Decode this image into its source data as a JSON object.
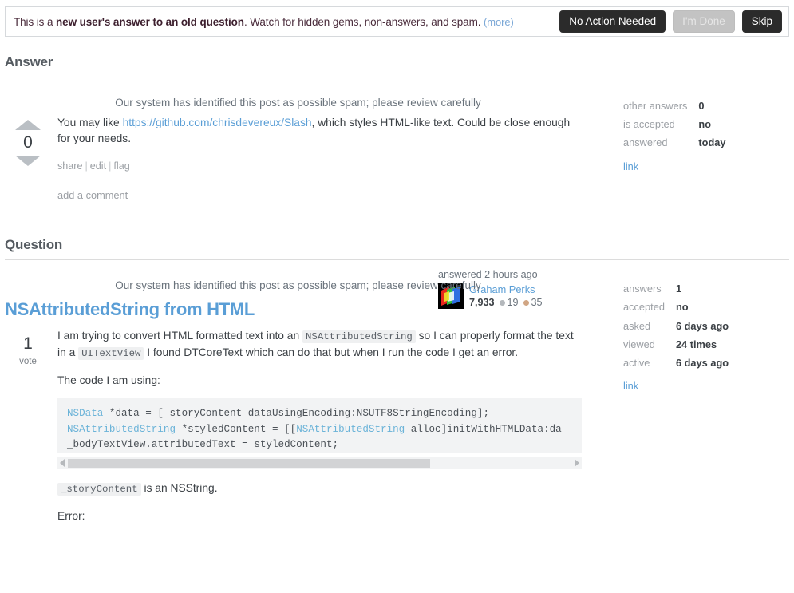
{
  "review": {
    "text_lead": "This is a ",
    "text_bold": "new user's answer to an old question",
    "text_tail": ". Watch for hidden gems, non-answers, and spam. ",
    "more_label": "(more)",
    "buttons": {
      "no_action": "No Action Needed",
      "done": "I'm Done",
      "skip": "Skip"
    }
  },
  "answer_section": {
    "heading": "Answer",
    "spam_notice": "Our system has identified this post as possible spam; please review carefully",
    "score": "0",
    "body_lead": "You may like ",
    "body_link": "https://github.com/chrisdevereux/Slash",
    "body_tail": ", which styles HTML-like text. Could be close enough for your needs.",
    "menu": {
      "share": "share",
      "edit": "edit",
      "flag": "flag"
    },
    "add_comment": "add a comment",
    "signature": {
      "action": "answered 2 hours ago",
      "user": "Graham Perks",
      "reputation": "7,933",
      "silver_badges": "19",
      "bronze_badges": "35"
    },
    "stats": {
      "rows": [
        {
          "key": "other answers",
          "value": "0"
        },
        {
          "key": "is accepted",
          "value": "no"
        },
        {
          "key": "answered",
          "value": "today"
        }
      ],
      "link": "link"
    }
  },
  "question_section": {
    "heading": "Question",
    "spam_notice": "Our system has identified this post as possible spam; please review carefully",
    "title": "NSAttributedString from HTML",
    "score": "1",
    "score_label": "vote",
    "para1": {
      "a": "I am trying to convert HTML formatted text into an ",
      "code1": "NSAttributedString",
      "b": " so I can properly format the text in a ",
      "code2": "UITextView",
      "c": " I found DTCoreText which can do that but when I run the code I get an error."
    },
    "para2": "The code I am using:",
    "code_lines": [
      {
        "type": "NSData",
        "rest": " *data = [_storyContent dataUsingEncoding:NSUTF8StringEncoding];"
      },
      {
        "type": "NSAttributedString",
        "rest": " *styledContent = [[",
        "type2": "NSAttributedString",
        "rest2": " alloc]initWithHTMLData:da"
      },
      {
        "type": "",
        "rest": "_bodyTextView.attributedText = styledContent;"
      }
    ],
    "para3": {
      "code": "_storyContent",
      "tail": " is an NSString."
    },
    "para4": "Error:",
    "stats": {
      "rows": [
        {
          "key": "answers",
          "value": "1"
        },
        {
          "key": "accepted",
          "value": "no"
        },
        {
          "key": "asked",
          "value": "6 days ago"
        },
        {
          "key": "viewed",
          "value": "24 times"
        },
        {
          "key": "active",
          "value": "6 days ago"
        }
      ],
      "link": "link"
    }
  },
  "colors": {
    "link": "#5a9ed6",
    "button_dark": "#2b2b2b",
    "button_disabled": "#c3c3c3",
    "code_bg": "#f2f3f4",
    "code_type": "#6bb3d8",
    "badge_silver": "#b4b8bc",
    "badge_bronze": "#d1a684"
  }
}
